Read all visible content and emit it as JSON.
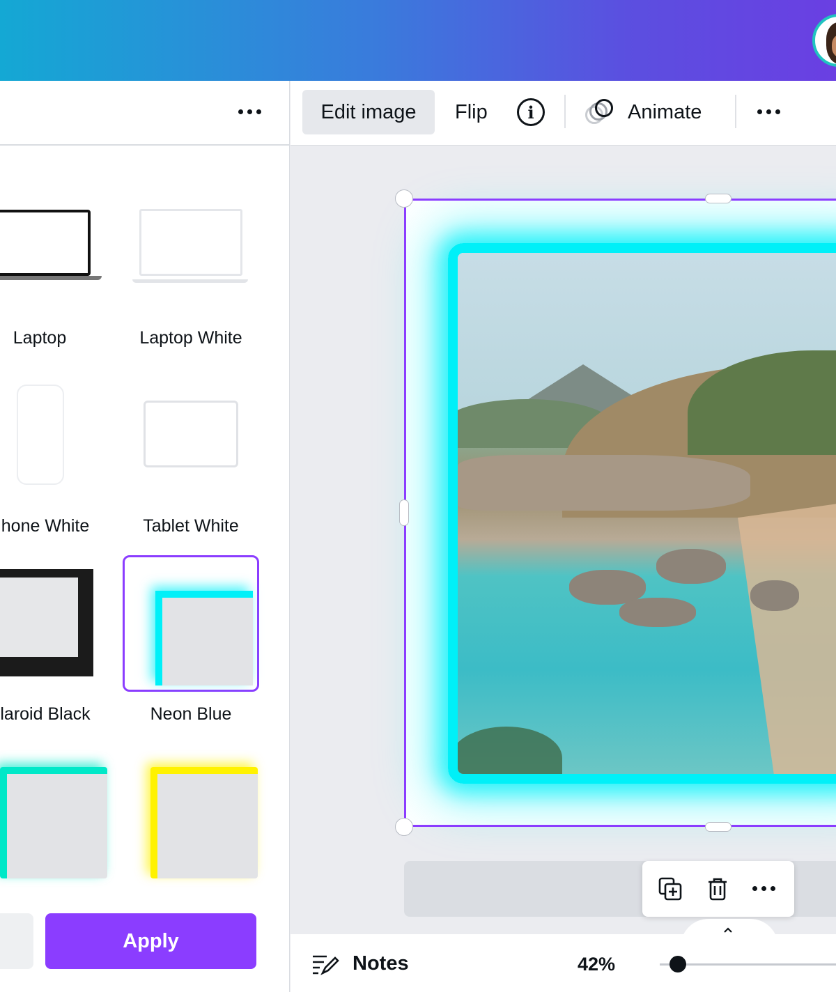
{
  "toolbar": {
    "edit_image_label": "Edit image",
    "flip_label": "Flip",
    "animate_label": "Animate"
  },
  "panel": {
    "items": [
      {
        "label": "Laptop"
      },
      {
        "label": "Laptop White"
      },
      {
        "label": "hone White"
      },
      {
        "label": "Tablet White"
      },
      {
        "label": "laroid Black"
      },
      {
        "label": "Neon Blue",
        "selected": true
      },
      {
        "label": ""
      },
      {
        "label": ""
      }
    ],
    "apply_label": "Apply"
  },
  "bottom": {
    "notes_label": "Notes",
    "zoom": "42%"
  },
  "colors": {
    "accent": "#8b3dff",
    "neon_blue": "#00f0f8",
    "neon_teal": "#00e8c8",
    "neon_yellow": "#fff200"
  },
  "icons": [
    "more-icon",
    "info-icon",
    "animate-icon",
    "duplicate-icon",
    "trash-icon",
    "chevron-up-icon",
    "notes-icon"
  ]
}
